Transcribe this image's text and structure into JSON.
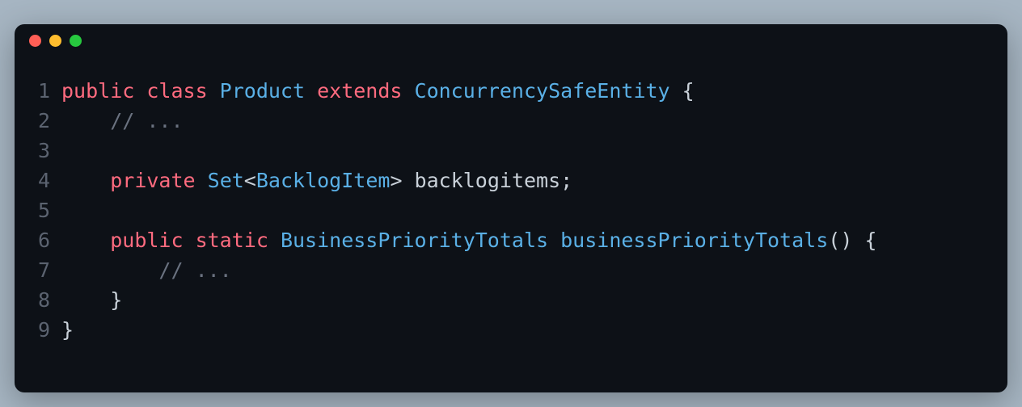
{
  "window": {
    "traffic_lights": {
      "red": "#ff5f56",
      "yellow": "#ffbd2e",
      "green": "#27c93f"
    }
  },
  "code": {
    "lines": [
      {
        "n": "1",
        "tokens": [
          {
            "t": "public ",
            "c": "tok-keyword"
          },
          {
            "t": "class ",
            "c": "tok-keyword"
          },
          {
            "t": "Product ",
            "c": "tok-type"
          },
          {
            "t": "extends ",
            "c": "tok-keyword"
          },
          {
            "t": "ConcurrencySafeEntity ",
            "c": "tok-type"
          },
          {
            "t": "{",
            "c": "tok-punct"
          }
        ]
      },
      {
        "n": "2",
        "tokens": [
          {
            "t": "    ",
            "c": "tok-default"
          },
          {
            "t": "// ...",
            "c": "tok-comment"
          }
        ]
      },
      {
        "n": "3",
        "tokens": []
      },
      {
        "n": "4",
        "tokens": [
          {
            "t": "    ",
            "c": "tok-default"
          },
          {
            "t": "private ",
            "c": "tok-keyword"
          },
          {
            "t": "Set",
            "c": "tok-type"
          },
          {
            "t": "<",
            "c": "tok-punct"
          },
          {
            "t": "BacklogItem",
            "c": "tok-type"
          },
          {
            "t": "> ",
            "c": "tok-punct"
          },
          {
            "t": "backlogitems",
            "c": "tok-default"
          },
          {
            "t": ";",
            "c": "tok-punct"
          }
        ]
      },
      {
        "n": "5",
        "tokens": []
      },
      {
        "n": "6",
        "tokens": [
          {
            "t": "    ",
            "c": "tok-default"
          },
          {
            "t": "public ",
            "c": "tok-keyword"
          },
          {
            "t": "static ",
            "c": "tok-keyword"
          },
          {
            "t": "BusinessPriorityTotals ",
            "c": "tok-type"
          },
          {
            "t": "businessPriorityTotals",
            "c": "tok-method"
          },
          {
            "t": "() {",
            "c": "tok-punct"
          }
        ]
      },
      {
        "n": "7",
        "tokens": [
          {
            "t": "        ",
            "c": "tok-default"
          },
          {
            "t": "// ...",
            "c": "tok-comment"
          }
        ]
      },
      {
        "n": "8",
        "tokens": [
          {
            "t": "    }",
            "c": "tok-punct"
          }
        ]
      },
      {
        "n": "9",
        "tokens": [
          {
            "t": "}",
            "c": "tok-punct"
          }
        ]
      }
    ]
  }
}
